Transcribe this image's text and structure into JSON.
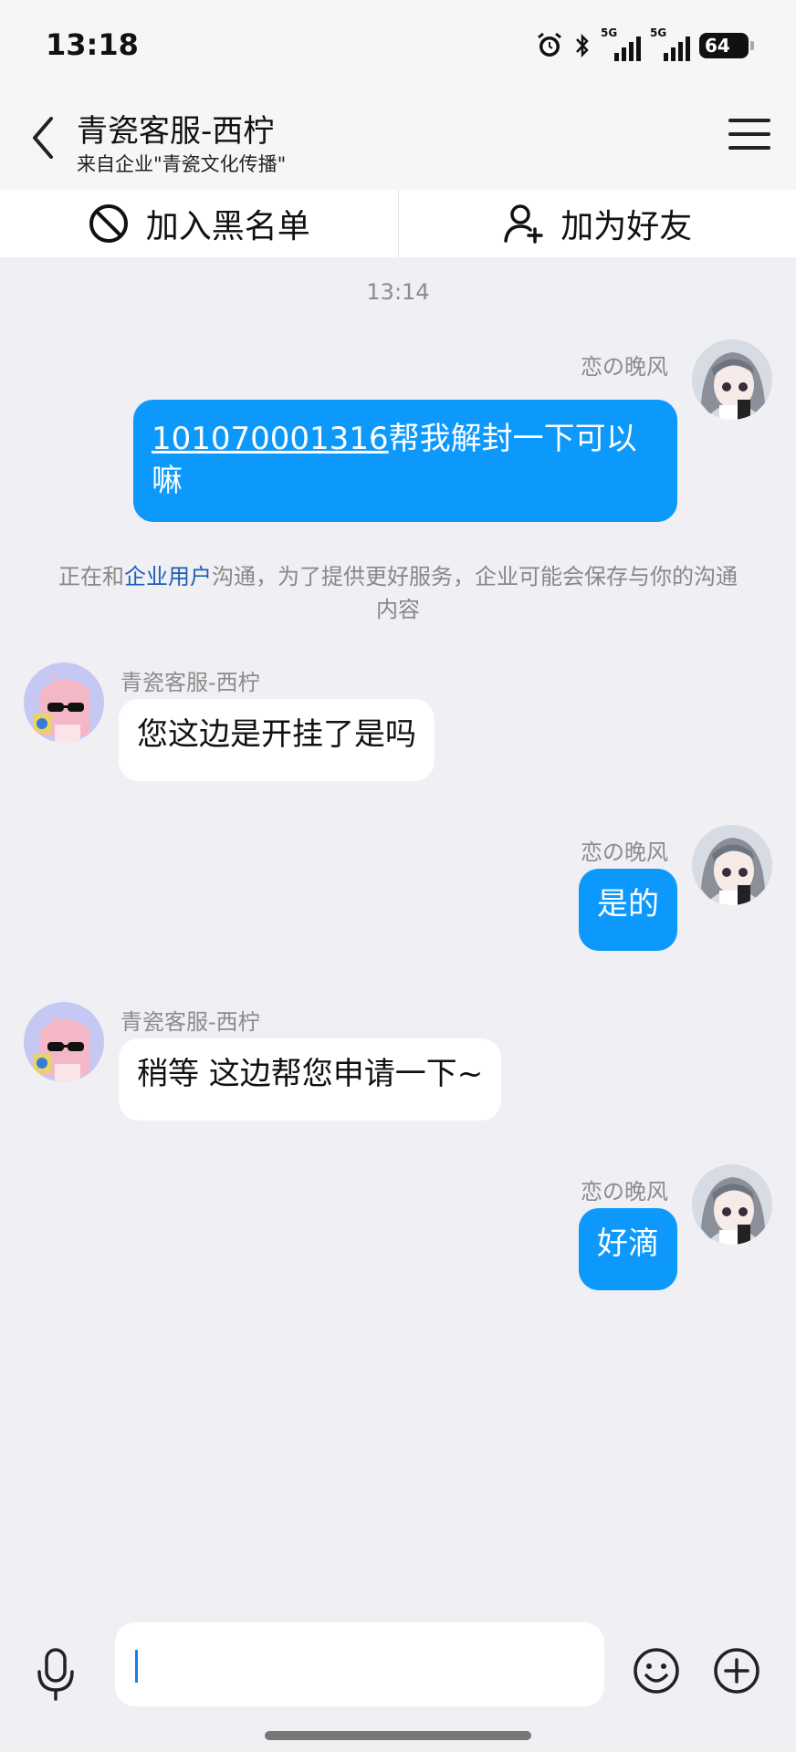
{
  "status": {
    "time": "13:18",
    "signal1": "5G",
    "signal2": "5G",
    "battery": "64"
  },
  "header": {
    "title": "青瓷客服-西柠",
    "subtitle": "来自企业\"青瓷文化传播\""
  },
  "actions": {
    "block": "加入黑名单",
    "add_friend": "加为好友"
  },
  "chat": {
    "timestamp": "13:14",
    "notice": {
      "pre": "正在和",
      "highlight": "企业用户",
      "post": "沟通，为了提供更好服务，企业可能会保存与你的沟通内容"
    },
    "messages": [
      {
        "direction": "out",
        "sender": "恋の晚风",
        "uid": "101070001316",
        "text": "帮我解封一下可以嘛"
      },
      {
        "direction": "in",
        "sender": "青瓷客服-西柠",
        "text": "您这边是开挂了是吗"
      },
      {
        "direction": "out",
        "sender": "恋の晚风",
        "text": "是的"
      },
      {
        "direction": "in",
        "sender": "青瓷客服-西柠",
        "text": "稍等 这边帮您申请一下~"
      },
      {
        "direction": "out",
        "sender": "恋の晚风",
        "text": "好滴"
      }
    ]
  },
  "colors": {
    "outgoing_bubble": "#0d99fc",
    "incoming_bubble": "#ffffff",
    "background": "#efeff4",
    "link": "#1e5fb4"
  }
}
